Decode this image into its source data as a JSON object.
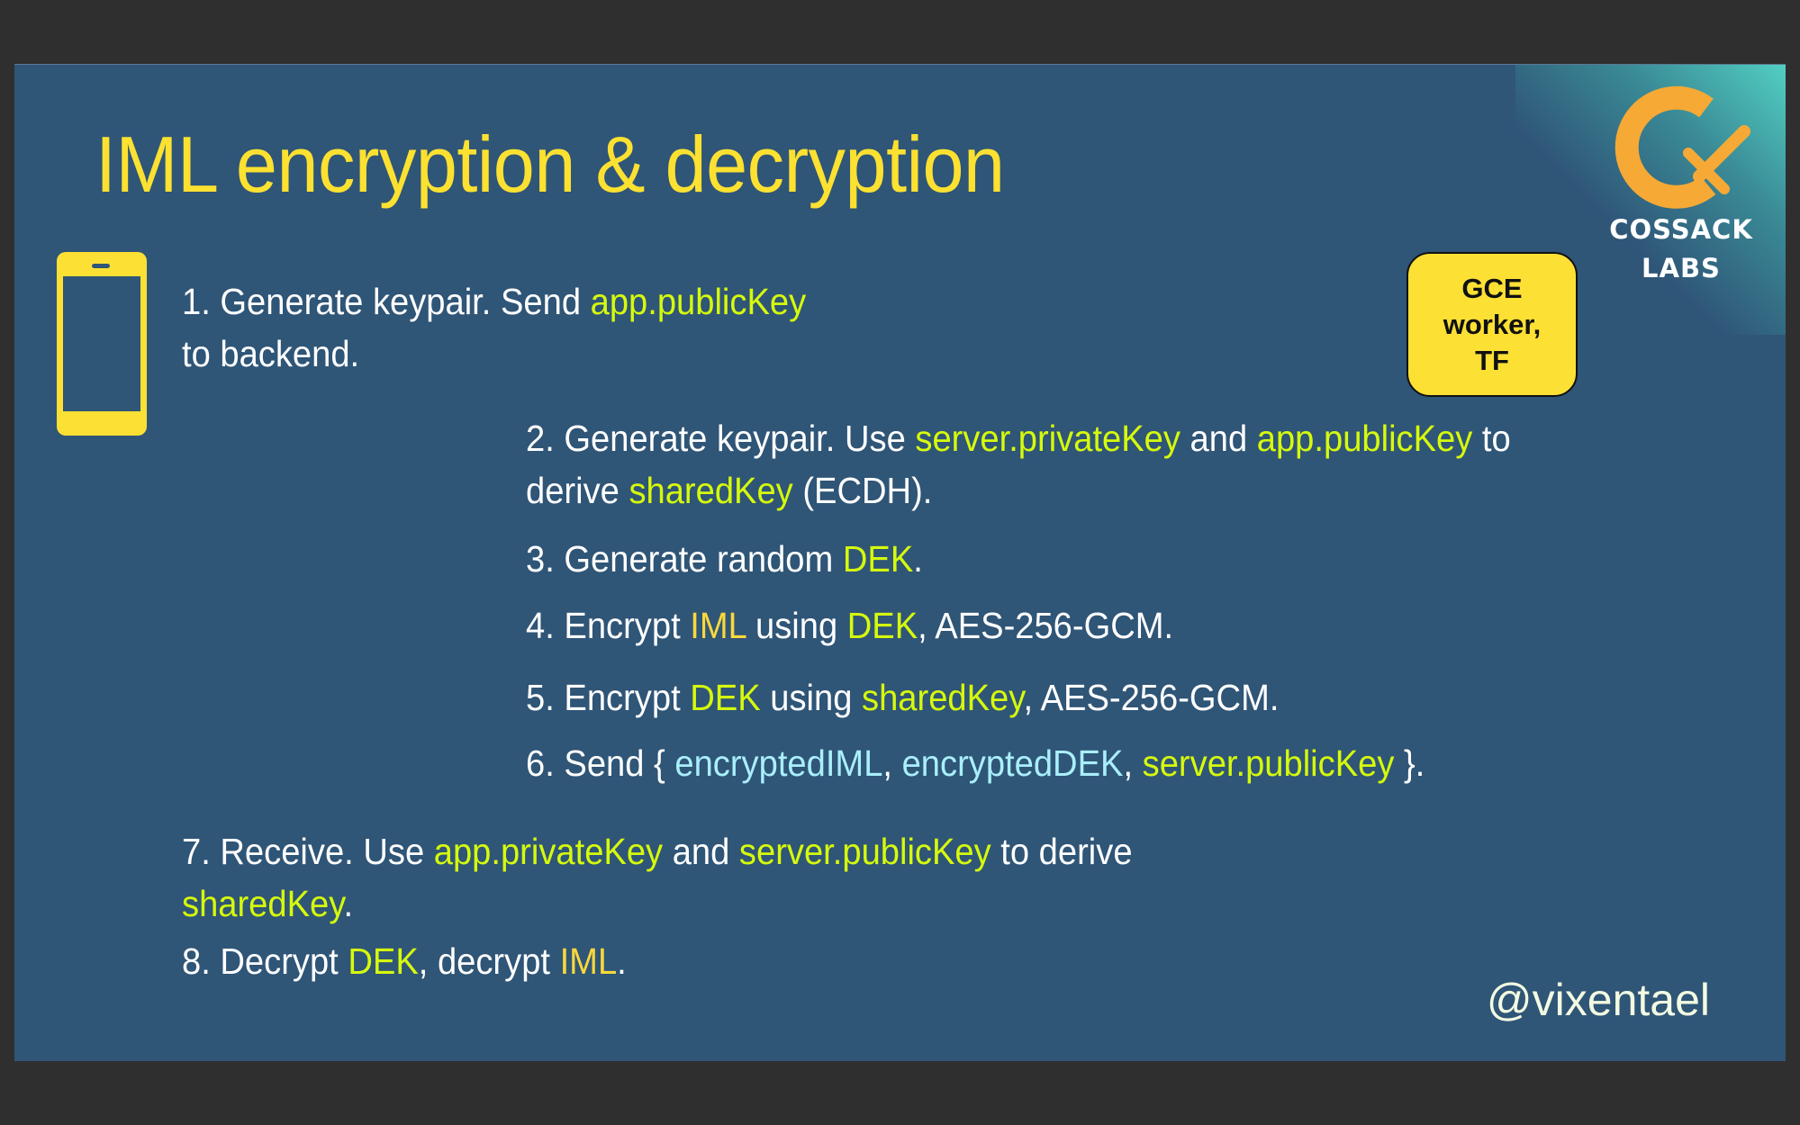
{
  "slide": {
    "title": "IML encryption & decryption",
    "logo": {
      "icon": "cossack-labs-logo-icon",
      "line1": "COSSACK",
      "line2": "LABS"
    },
    "phone_icon": "smartphone-icon",
    "badge": {
      "line1": "GCE",
      "line2": "worker,",
      "line3": "TF"
    },
    "handle": "@vixentael",
    "colors": {
      "background": "#2f5577",
      "title": "#fce131",
      "highlight": "#d6fa0c",
      "iml": "#f9d83c",
      "encrypted": "#a9effc",
      "logo": "#f6a935",
      "badge": "#fde034"
    },
    "steps": {
      "s1": {
        "a": "1. Generate keypair. Send ",
        "k1": "app.publicKey",
        "b": "to backend."
      },
      "s2": {
        "a": "2. Generate keypair. Use ",
        "k1": "server.privateKey",
        "b": " and ",
        "k2": "app.publicKey",
        "c": " to",
        "d": "derive ",
        "k3": "sharedKey",
        "e": " (ECDH)."
      },
      "s3": {
        "a": "3. Generate random ",
        "k1": "DEK",
        "b": "."
      },
      "s4": {
        "a": "4. Encrypt ",
        "k1": "IML",
        "b": " using ",
        "k2": "DEK",
        "c": ", AES-256-GCM."
      },
      "s5": {
        "a": "5. Encrypt ",
        "k1": "DEK",
        "b": " using ",
        "k2": "sharedKey",
        "c": ", AES-256-GCM."
      },
      "s6": {
        "a": "6. Send { ",
        "k1": "encryptedIML",
        "b": ", ",
        "k2": "encryptedDEK",
        "c": ", ",
        "k3": "server.publicKey",
        "d": " }."
      },
      "s7": {
        "a": "7. Receive. Use ",
        "k1": "app.privateKey",
        "b": " and ",
        "k2": "server.publicKey",
        "c": " to derive",
        "k3": "sharedKey",
        "d": "."
      },
      "s8": {
        "a": "8. Decrypt ",
        "k1": "DEK",
        "b": ", decrypt ",
        "k2": "IML",
        "c": "."
      }
    }
  }
}
